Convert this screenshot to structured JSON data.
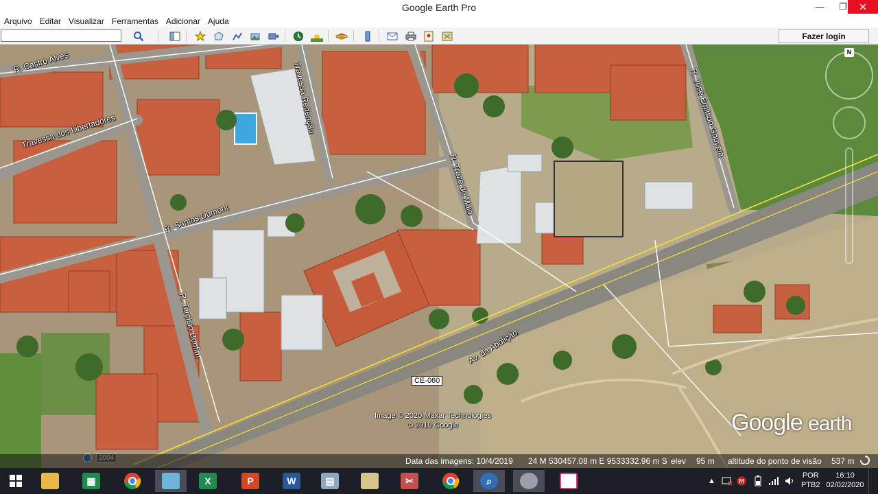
{
  "window": {
    "title": "Google Earth Pro",
    "minimize": "—",
    "maximize": "❐",
    "close": "✕"
  },
  "menu": [
    "Arquivo",
    "Editar",
    "Visualizar",
    "Ferramentas",
    "Adicionar",
    "Ajuda"
  ],
  "toolbar": {
    "search_value": "",
    "login_label": "Fazer login",
    "buttons": [
      "search-icon",
      "sidebar-toggle-icon",
      "placemark-icon",
      "polygon-icon",
      "path-icon",
      "image-overlay-icon",
      "record-tour-icon",
      "historical-imagery-icon",
      "sunlight-icon",
      "planets-icon",
      "ruler-icon",
      "email-icon",
      "print-icon",
      "save-image-icon",
      "google-maps-icon"
    ]
  },
  "map": {
    "roads": {
      "castro_alves": "R. Castro Alves",
      "libertadores": "Travessa dos Libertadores",
      "redencao": "Travessa Redenção",
      "santos_dumont": "R. Santos Dumont",
      "treze_maio": "R. Treze de Maio",
      "tarcisio": "R. Tarcísio Bonfim",
      "jose_emilson": "R. José Emilson Gouveia",
      "abolicao": "Av. da Abolição"
    },
    "highway_badge": "CE-060",
    "credits": [
      "Image © 2020 Maxar Technologies",
      "© 2019 Google"
    ],
    "logo_google": "Google",
    "logo_earth": "earth",
    "compass_n": "N",
    "year": "2004"
  },
  "status": {
    "image_date_label": "Data das imagens: 10/4/2019",
    "coordinates": "24 M 530457.08 m E 9533332.96 m S",
    "elev_label": "elev",
    "elev_value": "95 m",
    "eye_alt_label": "altitude do ponto de visão",
    "eye_alt_value": "537 m"
  },
  "taskbar": {
    "apps": [
      "windows-start-icon",
      "file-explorer-icon",
      "excel-icon",
      "chrome-icon",
      "notepad-icon",
      "excel-icon-2",
      "powerpoint-icon",
      "word-icon",
      "calculator-icon",
      "paint-icon",
      "snipping-tool-icon",
      "chrome-icon-2",
      "magnifier-icon",
      "google-earth-icon",
      "media-icon"
    ],
    "lang_1": "POR",
    "lang_2": "PTB2",
    "time": "16:10",
    "date": "02/02/2020"
  },
  "colors": {
    "close_red": "#e81123",
    "taskbar": "#1d1f27",
    "road_yellow": "#f2e33a",
    "roof_red": "#c85a3e",
    "vegetation": "#4e7a33"
  }
}
